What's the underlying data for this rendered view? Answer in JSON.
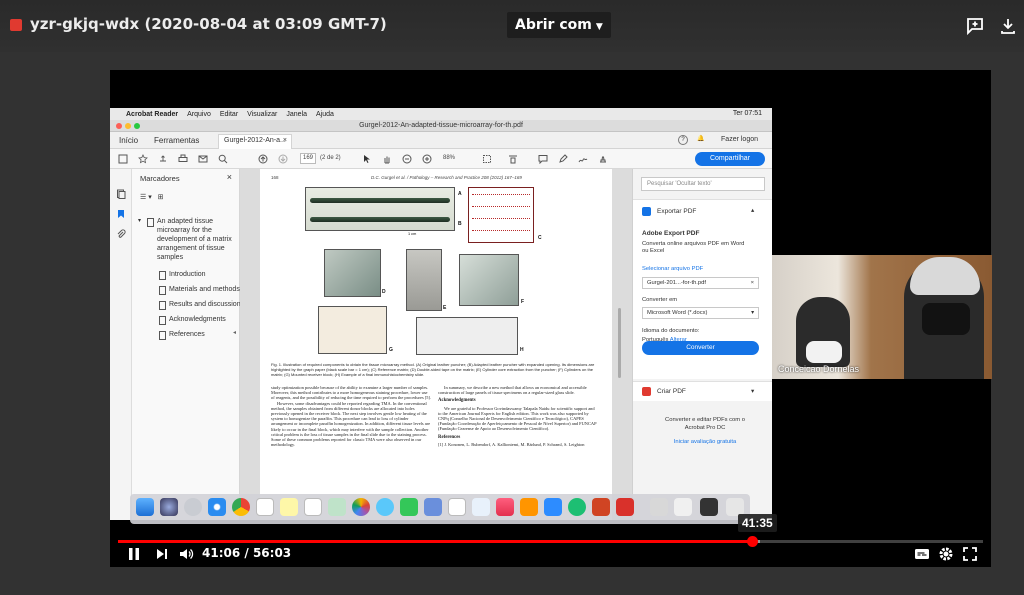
{
  "topbar": {
    "file_title": "yzr-gkjq-wdx (2020-08-04 at 03:09 GMT-7)",
    "open_with": "Abrir com"
  },
  "mac": {
    "menubar": {
      "app": "Acrobat Reader",
      "items": [
        "Arquivo",
        "Editar",
        "Visualizar",
        "Janela",
        "Ajuda"
      ],
      "clock": "Ter 07:51"
    },
    "window_title": "Gurgel-2012-An-adapted-tissue-microarray-for-th.pdf",
    "tabs": {
      "home": "Início",
      "tools": "Ferramentas",
      "doc": "Gurgel-2012-An-a...",
      "login": "Fazer logon"
    },
    "toolbar": {
      "page_current": "169",
      "page_count": "(2 de 2)",
      "zoom": "88%",
      "share": "Compartilhar"
    },
    "bookmarks": {
      "header": "Marcadores",
      "root": "An adapted tissue microarray for the development of a matrix arrangement of tissue samples",
      "children": [
        "Introduction",
        "Materials and methods",
        "Results and discussion",
        "Acknowledgments",
        "References"
      ]
    },
    "page": {
      "page_number": "168",
      "journal": "D.C. Gurgel et al. / Pathology – Research and Practice 208 (2012) 167–169",
      "labels": [
        "A",
        "B",
        "C",
        "D",
        "E",
        "F",
        "G",
        "H"
      ],
      "scale": "1 cm",
      "caption": "Fig. 1. Illustration of required components to obtain the tissue microarray method. (A) Original leather puncher; (B) Adapted leather puncher with expanded opening. Its dimensions are highlighted by the graph paper (black scale bar = 1 cm); (C) Reference matrix; (D) Double-sided tape on the matrix; (E) Cylinder core extraction from the puncher; (F) Cylinders on the matrix; (G) Mounted receiver block; (H) Example of a final immunohistochemistry slide.",
      "left_col": [
        "study optimization possible because of the ability to examine a larger number of samples. Moreover, this method contributes to a more homogeneous staining procedure, lower use of reagents, and the possibility of reducing the time required to perform the procedures [5].",
        "However, some disadvantages could be reported regarding TMA. In the conventional method, the samples obtained from different donor blocks are allocated into holes previously opened in the receiver block. The next step involves gentle low heating of the system to homogenize the paraffin. This procedure can lead to loss of cylinder arrangement or incomplete paraffin homogenization. In addition, different tissue levels are likely to occur in the final block, which may interfere with the sample collection. Another critical problem is the loss of tissue samples in the final slide due to the staining process. Some of these common problems reported for classic TMA were also observed in our methodology."
      ],
      "right_col": {
        "summary": "In summary, we describe a new method that allows an economical and accessible construction of large panels of tissue specimens on a regular-sized glass slide.",
        "ack_heading": "Acknowledgments",
        "ack_text": "We are grateful to Professor Govindaswamy Talapala Naidu for scientific support and to the American Journal Experts for English edition. This work was also supported by CNPq (Conselho Nacional de Desenvolvimento Científico e Tecnológico), CAPES (Fundação Coordenação de Aperfeiçoamento de Pessoal de Nível Superior) and FUNCAP (Fundação Cearense de Apoio ao Desenvolvimento Científico).",
        "ref_heading": "References",
        "ref_text": "[1] J. Kononen, L. Bubendorf, A. Kallioniemi, M. Bärlund, P. Schraml, S. Leighton"
      }
    },
    "right_panel": {
      "search_placeholder": "Pesquisar 'Ocultar texto'",
      "export_pdf": "Exportar PDF",
      "adobe_export": "Adobe Export PDF",
      "convert_desc": "Converta online arquivos PDF em Word ou Excel",
      "select_file": "Selecionar arquivo PDF",
      "file_name": "Gurgel-201...-for-th.pdf",
      "convert_to": "Converter em",
      "format": "Microsoft Word (*.docx)",
      "doc_lang": "Idioma do documento:",
      "lang": "Português",
      "change": "Alterar",
      "convert_btn": "Converter",
      "create_pdf": "Criar PDF",
      "promo": "Converter e editar PDFs com o Acrobat Pro DC",
      "trial": "Iniciar avaliação gratuita"
    }
  },
  "participant": {
    "name": "Conceicao Dornelas"
  },
  "player": {
    "current_time": "41:06",
    "duration": "56:03",
    "hover_time": "41:35",
    "progress": 0.733,
    "buffered": 0.742
  }
}
